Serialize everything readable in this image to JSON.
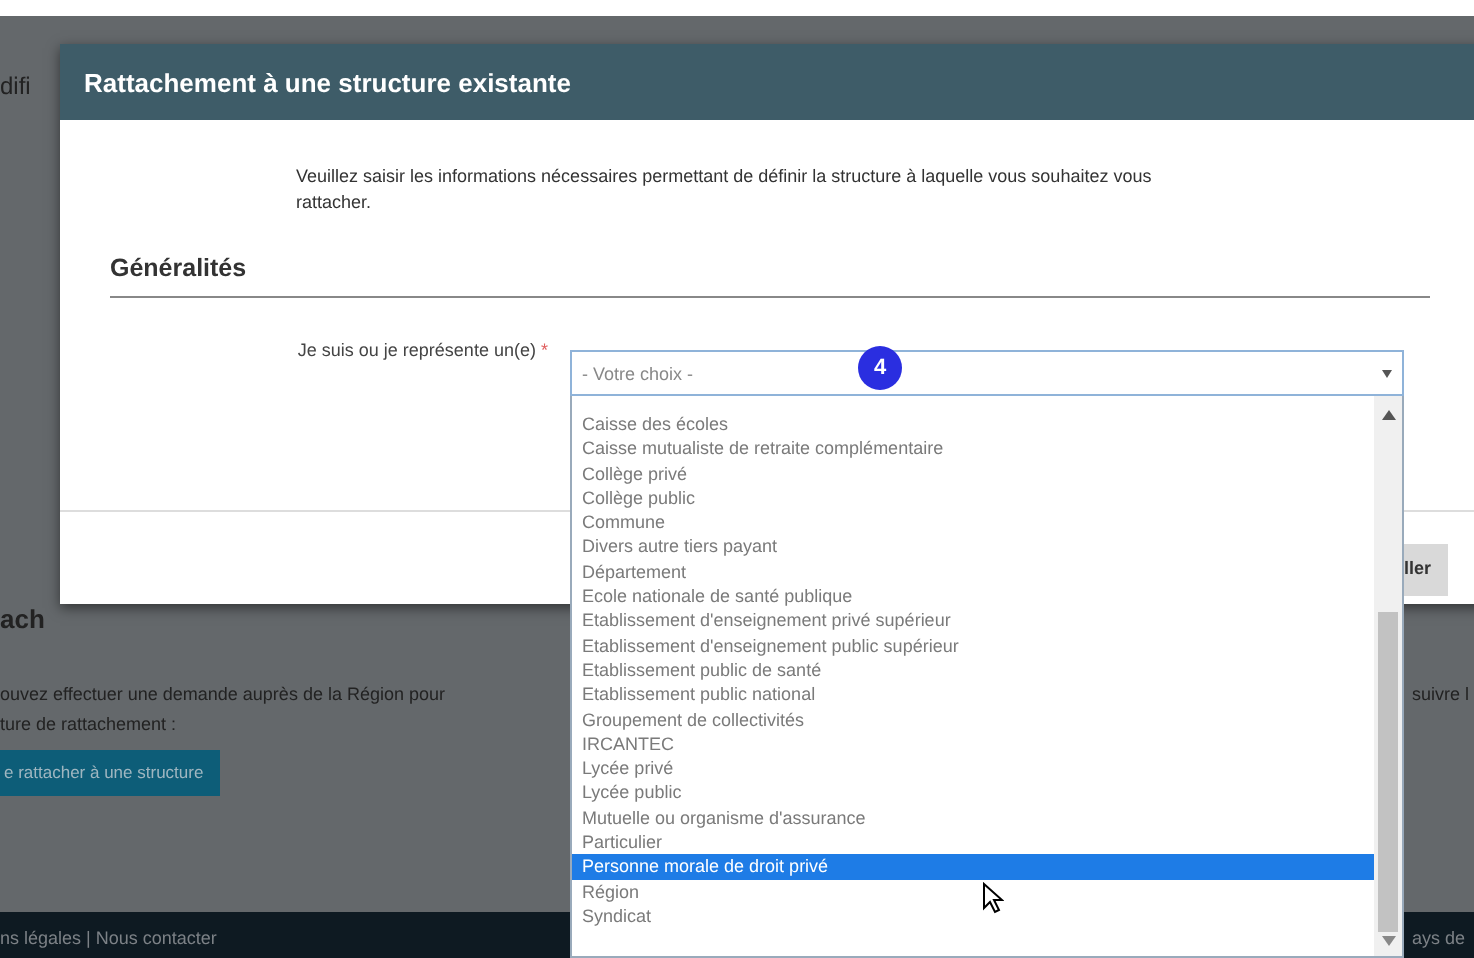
{
  "background_page": {
    "heading_fragment": "difi",
    "section_heading_fragment": "ach",
    "paragraph_line_1": "ouvez effectuer une demande auprès de la Région pour",
    "paragraph_line_1_end": "suivre l",
    "paragraph_line_2": "ture de rattachement :",
    "button": "e rattacher à une structure",
    "footer_links": "ns légales | Nous contacter",
    "footer_right": "ays de"
  },
  "modal": {
    "title": "Rattachement à une structure existante",
    "intro": "Veuillez saisir les informations nécessaires permettant de définir la structure à laquelle vous souhaitez vous rattacher.",
    "section": "Généralités",
    "field_label": "Je suis ou je représente un(e)",
    "required_mark": "*",
    "select": {
      "value": "- Votre choix -",
      "expanded": true
    },
    "footer_button": "ller"
  },
  "step_badge": "4",
  "options": [
    {
      "label": "Caisse des écoles",
      "selected": false
    },
    {
      "label": "Caisse mutualiste de retraite complémentaire",
      "selected": false
    },
    {
      "label": "Collège privé",
      "selected": false
    },
    {
      "label": "Collège public",
      "selected": false
    },
    {
      "label": "Commune",
      "selected": false
    },
    {
      "label": "Divers autre tiers payant",
      "selected": false
    },
    {
      "label": "Département",
      "selected": false
    },
    {
      "label": "Ecole nationale de santé publique",
      "selected": false
    },
    {
      "label": "Etablissement d'enseignement privé supérieur",
      "selected": false
    },
    {
      "label": "Etablissement d'enseignement public supérieur",
      "selected": false
    },
    {
      "label": "Etablissement public de santé",
      "selected": false
    },
    {
      "label": "Etablissement public national",
      "selected": false
    },
    {
      "label": "Groupement de collectivités",
      "selected": false
    },
    {
      "label": "IRCANTEC",
      "selected": false
    },
    {
      "label": "Lycée privé",
      "selected": false
    },
    {
      "label": "Lycée public",
      "selected": false
    },
    {
      "label": "Mutuelle ou organisme d'assurance",
      "selected": false
    },
    {
      "label": "Particulier",
      "selected": false
    },
    {
      "label": "Personne morale de droit privé",
      "selected": true
    },
    {
      "label": "Région",
      "selected": false
    },
    {
      "label": "Syndicat",
      "selected": false
    }
  ]
}
